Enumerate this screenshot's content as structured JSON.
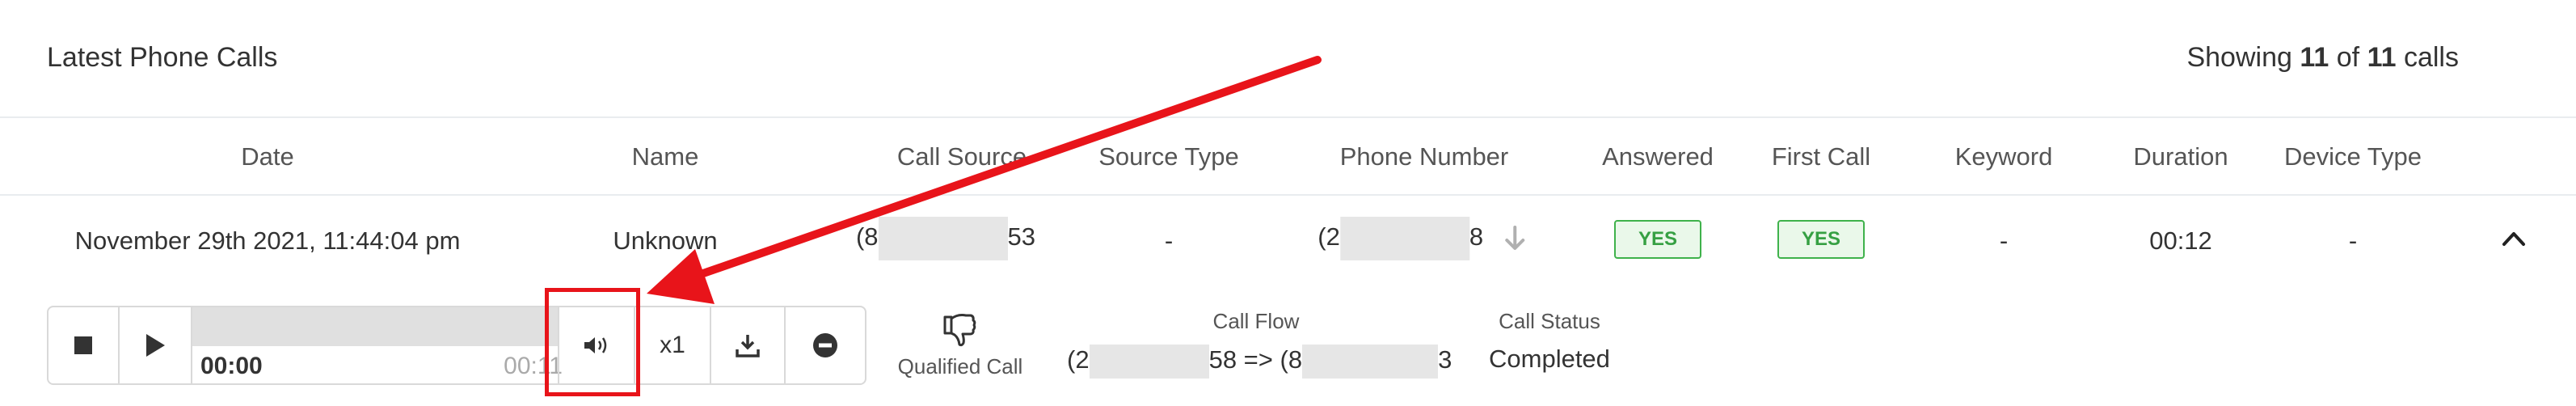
{
  "header": {
    "title": "Latest Phone Calls",
    "showing_prefix": "Showing",
    "showing_count": "11",
    "showing_of": "of",
    "showing_total": "11",
    "showing_suffix": "calls"
  },
  "table": {
    "columns": [
      "Date",
      "Name",
      "Call Source",
      "Source Type",
      "Phone Number",
      "Answered",
      "First Call",
      "Keyword",
      "Duration",
      "Device Type"
    ],
    "row": {
      "date": "November 29th 2021, 11:44:04 pm",
      "name": "Unknown",
      "call_source_start": "(8",
      "call_source_end": "53",
      "source_type": "-",
      "phone_start": "(2",
      "phone_end": "8",
      "answered": "YES",
      "first_call": "YES",
      "keyword": "-",
      "duration": "00:12",
      "device_type": "-"
    }
  },
  "player": {
    "current_time": "00:00",
    "total_time": "00:11",
    "speed": "x1"
  },
  "details": {
    "qualified_label": "Qualified Call",
    "call_flow_label": "Call Flow",
    "call_flow_start": "(2",
    "call_flow_mid": "58 => (8",
    "call_flow_end": "3",
    "call_status_label": "Call Status",
    "call_status": "Completed"
  },
  "colors": {
    "badge_green": "#3fb24b",
    "annotation_red": "#e8141a"
  },
  "icons": [
    "stop-icon",
    "play-icon",
    "volume-icon",
    "download-icon",
    "remove-icon",
    "thumbs-down-icon",
    "arrow-down-icon",
    "chevron-up-icon"
  ]
}
